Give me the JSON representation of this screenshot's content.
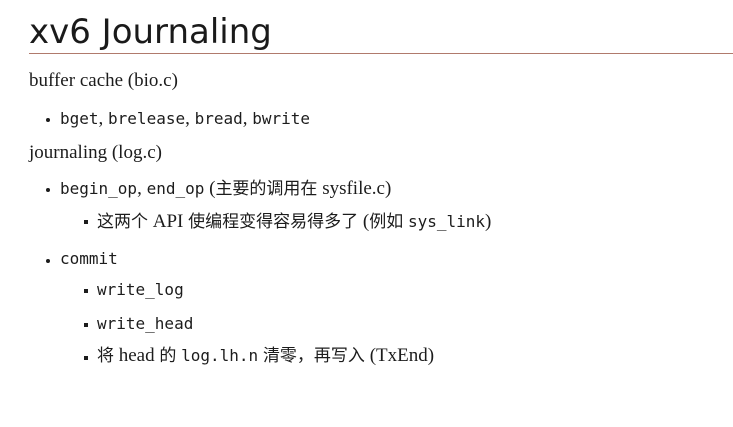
{
  "title": "xv6 Journaling",
  "sections": [
    {
      "heading": "buffer cache (bio.c)",
      "items": [
        {
          "parts": [
            {
              "text": "bget",
              "style": "mono"
            },
            {
              "text": ", ",
              "style": "serif"
            },
            {
              "text": "brelease",
              "style": "mono"
            },
            {
              "text": ", ",
              "style": "serif"
            },
            {
              "text": "bread",
              "style": "mono"
            },
            {
              "text": ", ",
              "style": "serif"
            },
            {
              "text": "bwrite",
              "style": "mono"
            }
          ]
        }
      ]
    },
    {
      "heading": "journaling (log.c)",
      "items": [
        {
          "parts": [
            {
              "text": "begin_op",
              "style": "mono"
            },
            {
              "text": ", ",
              "style": "serif"
            },
            {
              "text": "end_op",
              "style": "mono"
            },
            {
              "text": " (",
              "style": "serif"
            },
            {
              "text": "主要的调用在",
              "style": "cjk"
            },
            {
              "text": " sysfile.c)",
              "style": "serif"
            }
          ],
          "sub": [
            {
              "parts": [
                {
                  "text": "这两个",
                  "style": "cjk"
                },
                {
                  "text": " API ",
                  "style": "serif"
                },
                {
                  "text": "使编程变得容易得多了",
                  "style": "cjk"
                },
                {
                  "text": " (",
                  "style": "serif"
                },
                {
                  "text": "例如",
                  "style": "cjk"
                },
                {
                  "text": " ",
                  "style": "serif"
                },
                {
                  "text": "sys_link",
                  "style": "mono"
                },
                {
                  "text": ")",
                  "style": "serif"
                }
              ]
            }
          ]
        },
        {
          "parts": [
            {
              "text": "commit",
              "style": "mono"
            }
          ],
          "sub": [
            {
              "parts": [
                {
                  "text": "write_log",
                  "style": "mono"
                }
              ]
            },
            {
              "parts": [
                {
                  "text": "write_head",
                  "style": "mono"
                }
              ]
            },
            {
              "parts": [
                {
                  "text": "将",
                  "style": "cjk"
                },
                {
                  "text": " head ",
                  "style": "serif"
                },
                {
                  "text": "的",
                  "style": "cjk"
                },
                {
                  "text": " ",
                  "style": "serif"
                },
                {
                  "text": "log.lh.n",
                  "style": "mono"
                },
                {
                  "text": " ",
                  "style": "serif"
                },
                {
                  "text": "清零，再写入",
                  "style": "cjk"
                },
                {
                  "text": " (TxEnd)",
                  "style": "serif"
                }
              ]
            }
          ]
        }
      ]
    }
  ]
}
